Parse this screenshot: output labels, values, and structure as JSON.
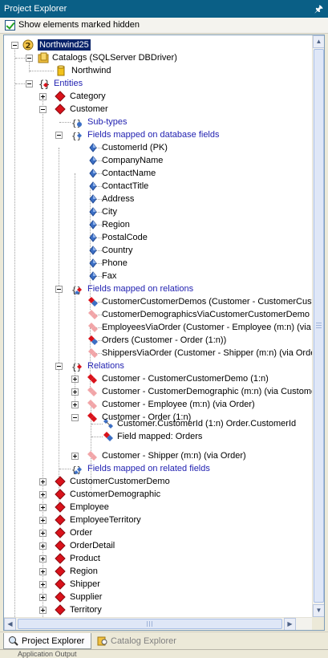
{
  "panel": {
    "title": "Project Explorer",
    "pin_icon": "pin-icon"
  },
  "options": {
    "show_hidden_label": "Show elements marked hidden",
    "show_hidden_checked": true
  },
  "tree": {
    "project": "Northwind25",
    "catalogs": "Catalogs (SQLServer DBDriver)",
    "catalog_northwind": "Northwind",
    "entities": "Entities",
    "category": "Category",
    "customer": "Customer",
    "subtypes": "Sub-types",
    "fields_db": "Fields mapped on database fields",
    "db_fields": [
      "CustomerId (PK)",
      "CompanyName",
      "ContactName",
      "ContactTitle",
      "Address",
      "City",
      "Region",
      "PostalCode",
      "Country",
      "Phone",
      "Fax"
    ],
    "fields_rel": "Fields mapped on relations",
    "rel_fields": [
      "CustomerCustomerDemos (Customer - CustomerCustomerDemo",
      "CustomerDemographicsViaCustomerCustomerDemo (Cus",
      "EmployeesViaOrder (Customer - Employee (m:n) (via Orde",
      "Orders (Customer - Order (1:n))",
      "ShippersViaOrder (Customer - Shipper (m:n) (via Order))"
    ],
    "relations": "Relations",
    "relation_items": [
      "Customer - CustomerCustomerDemo (1:n)",
      "Customer - CustomerDemographic (m:n) (via CustomerCu",
      "Customer - Employee (m:n) (via Order)",
      "Customer - Order (1:n)",
      "Customer - Shipper (m:n) (via Order)"
    ],
    "order_rel_field": "Customer.CustomerId (1:n) Order.CustomerId",
    "order_rel_mapped": "Field mapped: Orders",
    "fields_related": "Fields mapped on related fields",
    "other_entities": [
      "CustomerCustomerDemo",
      "CustomerDemographic",
      "Employee",
      "EmployeeTerritory",
      "Order",
      "OrderDetail",
      "Product",
      "Region",
      "Shipper",
      "Supplier",
      "Territory"
    ]
  },
  "tabs": {
    "project_explorer": "Project Explorer",
    "catalog_explorer": "Catalog Explorer"
  },
  "bottom_strip": "Application Output",
  "colors": {
    "titlebar": "#0a5f86",
    "selection": "#0a246a",
    "folder_text": "#1f1fb0",
    "entity_red": "#d9121b",
    "field_blue": "#3c6fc4"
  }
}
